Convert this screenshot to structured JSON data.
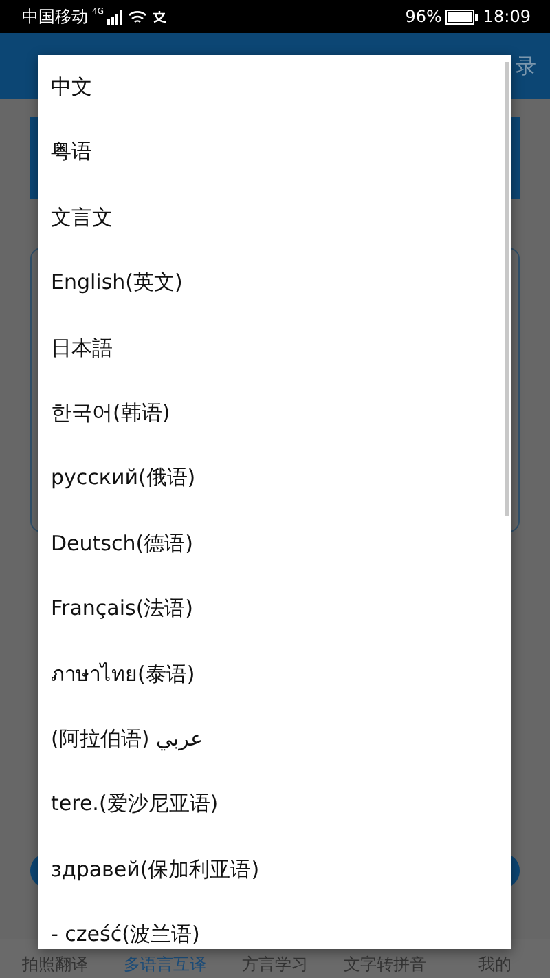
{
  "status_bar": {
    "carrier": "中国移动",
    "network": "4G",
    "battery": "96%",
    "time": "18:09"
  },
  "app_bar": {
    "action": "录"
  },
  "dialog": {
    "languages": [
      "中文",
      "粤语",
      "文言文",
      "English(英文)",
      "日本語",
      "한국어(韩语)",
      "русский(俄语)",
      "Deutsch(德语)",
      "Français(法语)",
      "ภาษาไทย(泰语)",
      "(阿拉伯语) عربي",
      "tere.(爱沙尼亚语)",
      "здравей(保加利亚语)",
      "- cześć(波兰语)"
    ]
  },
  "bottom_nav": [
    {
      "label": "拍照翻译",
      "selected": false
    },
    {
      "label": "多语言互译",
      "selected": true
    },
    {
      "label": "方言学习",
      "selected": false
    },
    {
      "label": "文字转拼音",
      "selected": false
    },
    {
      "label": "我的",
      "selected": false
    }
  ]
}
